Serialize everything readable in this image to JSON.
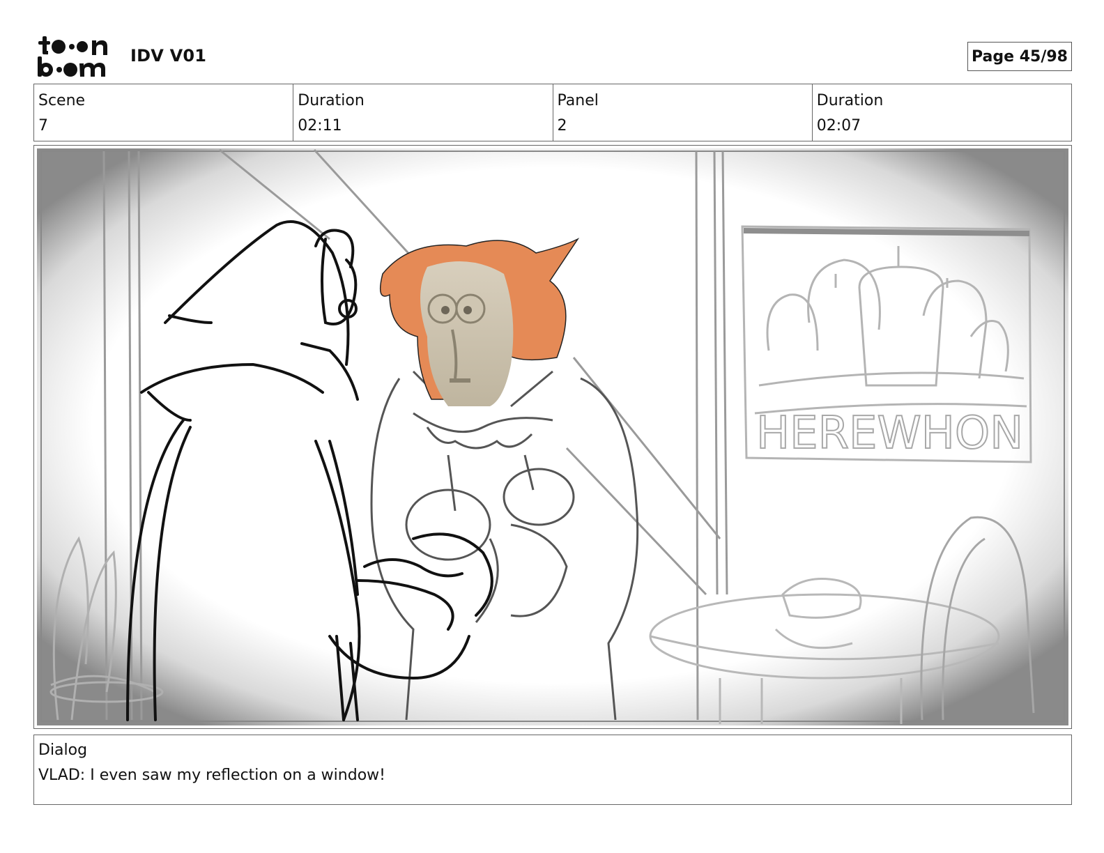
{
  "header": {
    "logo_text": "toon boom",
    "project_title": "IDV V01",
    "page_label": "Page 45/98"
  },
  "info": {
    "scene_label": "Scene",
    "scene_value": "7",
    "scene_duration_label": "Duration",
    "scene_duration_value": "02:11",
    "panel_label": "Panel",
    "panel_value": "2",
    "panel_duration_label": "Duration",
    "panel_duration_value": "02:07"
  },
  "panel": {
    "sign_text": "HEREWHON"
  },
  "dialog": {
    "label": "Dialog",
    "text": "VLAD: I even saw my reflection on a window!"
  }
}
